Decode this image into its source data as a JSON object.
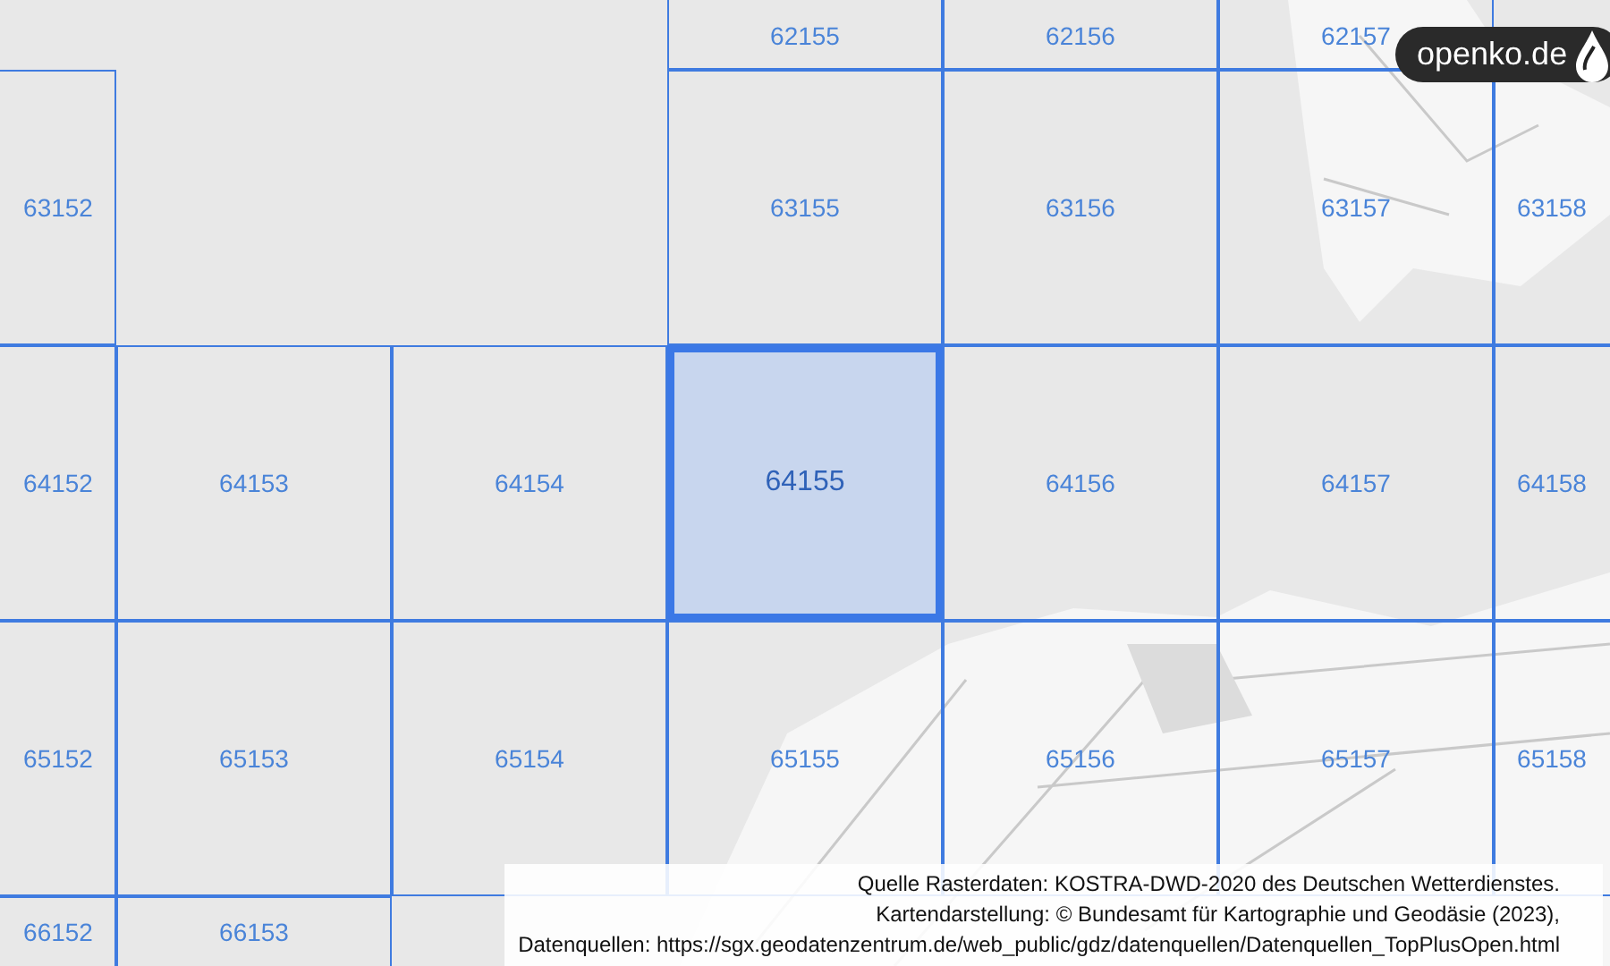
{
  "grid": {
    "rows": [
      {
        "cells": [
          null,
          null,
          null,
          {
            "label": "62155",
            "selected": false
          },
          {
            "label": "62156",
            "selected": false
          },
          {
            "label": "62157",
            "selected": false
          },
          null
        ]
      },
      {
        "cells": [
          {
            "label": "63152",
            "selected": false
          },
          null,
          null,
          {
            "label": "63155",
            "selected": false
          },
          {
            "label": "63156",
            "selected": false
          },
          {
            "label": "63157",
            "selected": false
          },
          {
            "label": "63158",
            "selected": false
          }
        ]
      },
      {
        "cells": [
          {
            "label": "64152",
            "selected": false
          },
          {
            "label": "64153",
            "selected": false
          },
          {
            "label": "64154",
            "selected": false
          },
          {
            "label": "64155",
            "selected": true
          },
          {
            "label": "64156",
            "selected": false
          },
          {
            "label": "64157",
            "selected": false
          },
          {
            "label": "64158",
            "selected": false
          }
        ]
      },
      {
        "cells": [
          {
            "label": "65152",
            "selected": false
          },
          {
            "label": "65153",
            "selected": false
          },
          {
            "label": "65154",
            "selected": false
          },
          {
            "label": "65155",
            "selected": false
          },
          {
            "label": "65156",
            "selected": false
          },
          {
            "label": "65157",
            "selected": false
          },
          {
            "label": "65158",
            "selected": false
          }
        ]
      },
      {
        "cells": [
          {
            "label": "66152",
            "selected": false
          },
          {
            "label": "66153",
            "selected": false
          },
          null,
          null,
          null,
          null,
          null
        ]
      }
    ]
  },
  "logo": {
    "text": "openko.de"
  },
  "attribution": [
    "Quelle Rasterdaten: KOSTRA-DWD-2020 des Deutschen Wetterdienstes.",
    "Kartendarstellung: © Bundesamt für Kartographie und Geodäsie (2023),",
    "Datenquellen: https://sgx.geodatenzentrum.de/web_public/gdz/datenquellen/Datenquellen_TopPlusOpen.html"
  ]
}
